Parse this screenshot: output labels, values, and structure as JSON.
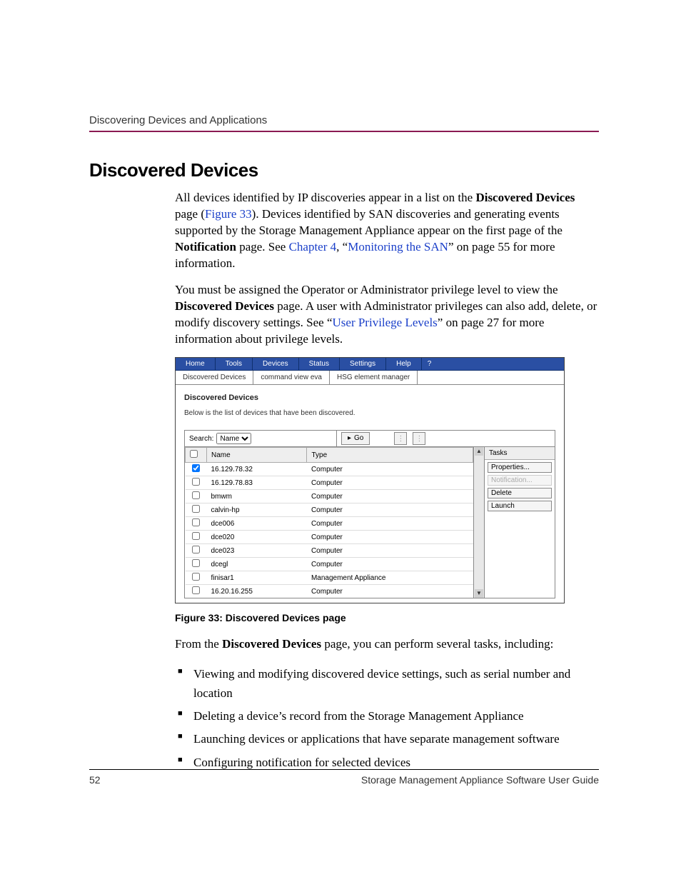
{
  "header": {
    "running": "Discovering Devices and Applications"
  },
  "title": "Discovered Devices",
  "para1": {
    "t1": "All devices identified by IP discoveries appear in a list on the ",
    "b1": "Discovered Devices",
    "t2": " page (",
    "l1": "Figure 33",
    "t3": "). Devices identified by SAN discoveries and generating events supported by the Storage Management Appliance appear on the first page of the ",
    "b2": "Notification",
    "t4": " page. See ",
    "l2": "Chapter 4",
    "t5": ", “",
    "l3": "Monitoring the SAN",
    "t6": "” on page 55 for more information."
  },
  "para2": {
    "t1": "You must be assigned the Operator or Administrator privilege level to view the ",
    "b1": "Discovered Devices",
    "t2": " page. A user with Administrator privileges can also add, delete, or modify discovery settings. See “",
    "l1": "User Privilege Levels",
    "t3": "” on page 27 for more information about privilege levels."
  },
  "screenshot": {
    "menu": [
      "Home",
      "Tools",
      "Devices",
      "Status",
      "Settings",
      "Help"
    ],
    "qmark": "?",
    "submenu": [
      "Discovered Devices",
      "command view eva",
      "HSG element manager"
    ],
    "panel_title": "Discovered Devices",
    "panel_desc": "Below is the list of devices that have been discovered.",
    "search_label": "Search:",
    "search_field": "Name",
    "go_label": "Go",
    "columns": {
      "name": "Name",
      "type": "Type"
    },
    "rows": [
      {
        "checked": true,
        "name": "16.129.78.32",
        "type": "Computer"
      },
      {
        "checked": false,
        "name": "16.129.78.83",
        "type": "Computer"
      },
      {
        "checked": false,
        "name": "bmwm",
        "type": "Computer"
      },
      {
        "checked": false,
        "name": "calvin-hp",
        "type": "Computer"
      },
      {
        "checked": false,
        "name": "dce006",
        "type": "Computer"
      },
      {
        "checked": false,
        "name": "dce020",
        "type": "Computer"
      },
      {
        "checked": false,
        "name": "dce023",
        "type": "Computer"
      },
      {
        "checked": false,
        "name": "dcegl",
        "type": "Computer"
      },
      {
        "checked": false,
        "name": "finisar1",
        "type": "Management Appliance"
      },
      {
        "checked": false,
        "name": "16.20.16.255",
        "type": "Computer"
      }
    ],
    "tasks_header": "Tasks",
    "tasks": [
      {
        "label": "Properties...",
        "disabled": false
      },
      {
        "label": "Notification...",
        "disabled": true
      },
      {
        "label": "Delete",
        "disabled": false
      },
      {
        "label": "Launch",
        "disabled": false
      }
    ]
  },
  "caption": "Figure 33:  Discovered Devices page",
  "para3": {
    "t1": "From the ",
    "b1": "Discovered Devices",
    "t2": " page, you can perform several tasks, including:"
  },
  "bullets": [
    "Viewing and modifying discovered device settings, such as serial number and location",
    "Deleting a device’s record from the Storage Management Appliance",
    "Launching devices or applications that have separate management software",
    "Configuring notification for selected devices"
  ],
  "footer": {
    "pagenum": "52",
    "booktitle": "Storage Management Appliance Software User Guide"
  }
}
